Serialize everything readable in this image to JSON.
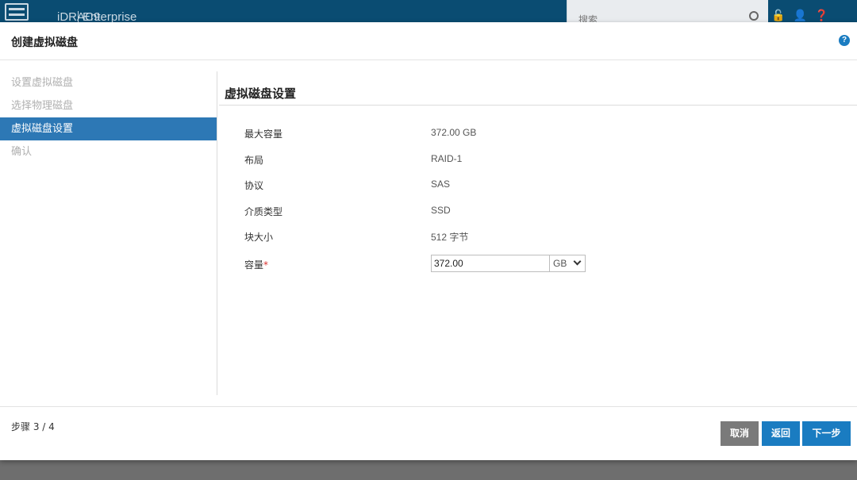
{
  "app": {
    "title": "iDRAC9",
    "edition": "Enterprise",
    "search_placeholder": "搜索"
  },
  "dialog": {
    "title": "创建虚拟磁盘",
    "help": "?"
  },
  "steps": [
    {
      "label": "设置虚拟磁盘",
      "active": false
    },
    {
      "label": "选择物理磁盘",
      "active": false
    },
    {
      "label": "虚拟磁盘设置",
      "active": true
    },
    {
      "label": "确认",
      "active": false
    }
  ],
  "section_title": "虚拟磁盘设置",
  "fields": {
    "max_capacity": {
      "label": "最大容量",
      "value": "372.00 GB"
    },
    "layout": {
      "label": "布局",
      "value": "RAID-1"
    },
    "protocol": {
      "label": "协议",
      "value": "SAS"
    },
    "media_type": {
      "label": "介质类型",
      "value": "SSD"
    },
    "block_size": {
      "label": "块大小",
      "value": "512 字节"
    },
    "capacity": {
      "label": "容量",
      "required_mark": "*",
      "value": "372.00",
      "unit": "GB"
    }
  },
  "footer": {
    "step_count": "步骤 3 / 4",
    "cancel": "取消",
    "back": "返回",
    "next": "下一步"
  }
}
